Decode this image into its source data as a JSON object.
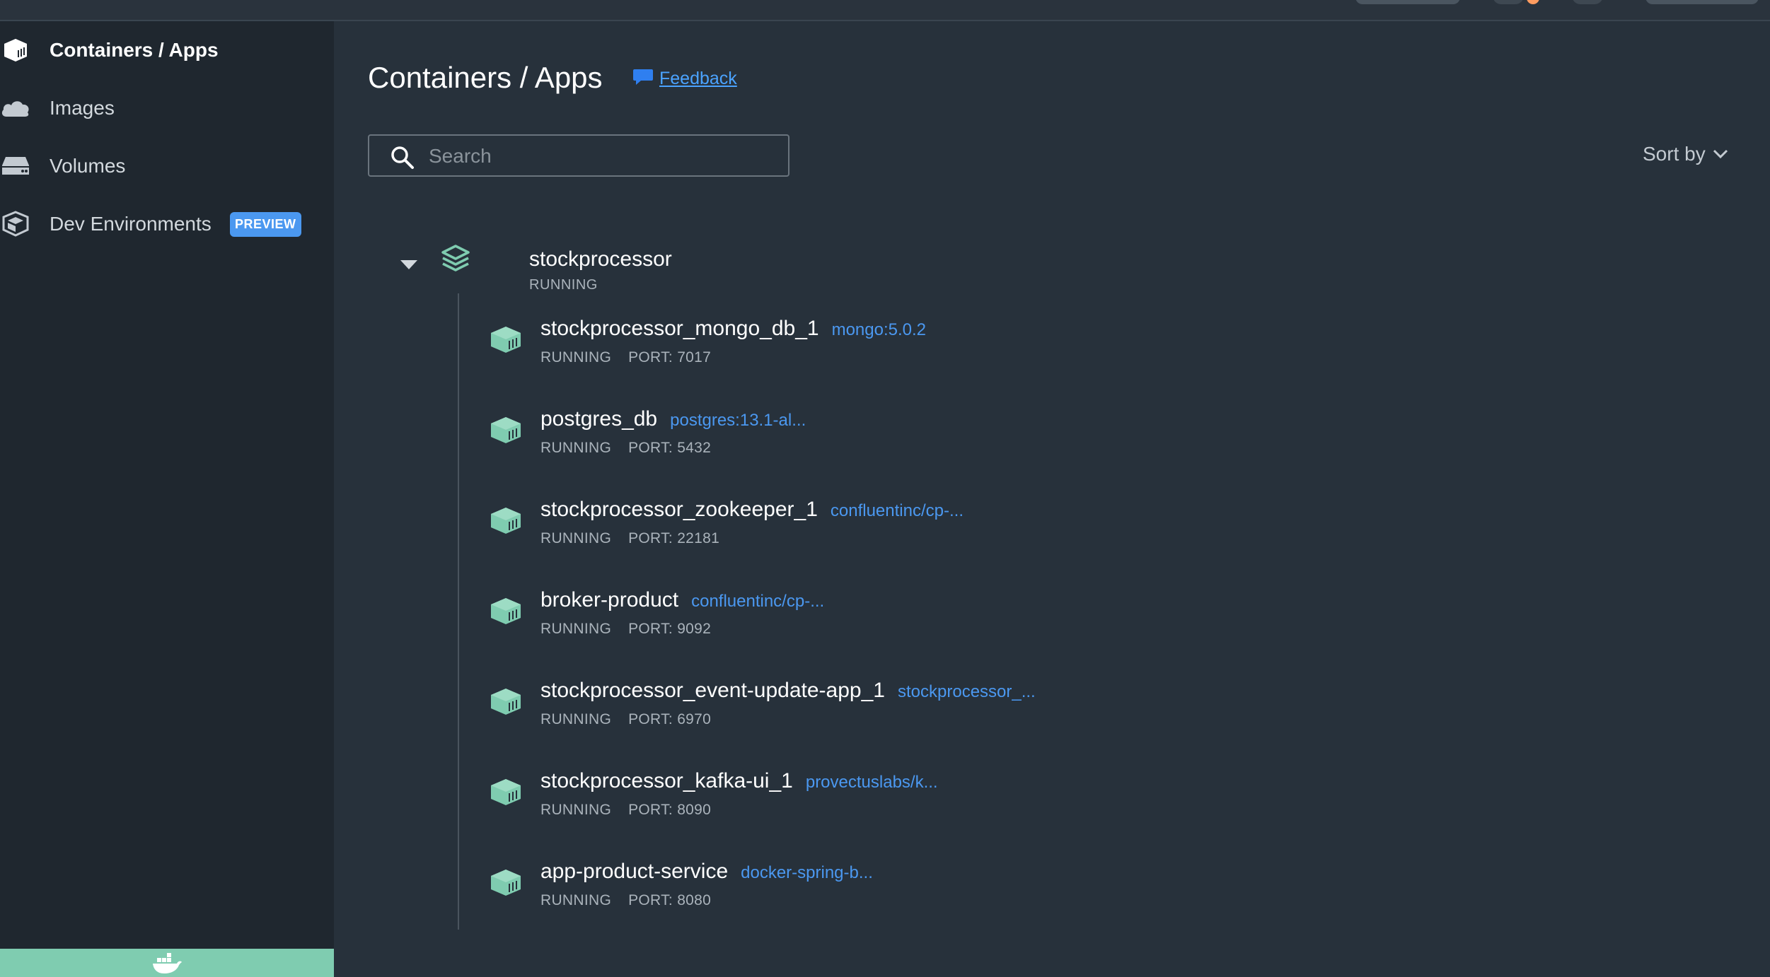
{
  "colors": {
    "background": "#27313b",
    "sidebar": "#1f272f",
    "accent_blue": "#4b98f0",
    "running_green": "#7fccb0",
    "muted_text": "#aab3bb"
  },
  "sidebar": {
    "items": [
      {
        "label": "Containers / Apps",
        "icon": "container-icon",
        "active": true
      },
      {
        "label": "Images",
        "icon": "cloud-icon",
        "active": false
      },
      {
        "label": "Volumes",
        "icon": "volume-icon",
        "active": false
      },
      {
        "label": "Dev Environments",
        "icon": "dev-environments-icon",
        "active": false,
        "badge": "PREVIEW"
      }
    ],
    "footer_icon": "docker-whale-icon"
  },
  "main": {
    "title": "Containers / Apps",
    "feedback_label": "Feedback",
    "search": {
      "placeholder": "Search",
      "value": ""
    },
    "sort_label": "Sort by",
    "group": {
      "name": "stockprocessor",
      "status": "RUNNING",
      "expanded": true,
      "containers": [
        {
          "name": "stockprocessor_mongo_db_1",
          "image": "mongo:5.0.2",
          "status": "RUNNING",
          "port": "PORT: 7017"
        },
        {
          "name": "postgres_db",
          "image": "postgres:13.1-al...",
          "status": "RUNNING",
          "port": "PORT: 5432"
        },
        {
          "name": "stockprocessor_zookeeper_1",
          "image": "confluentinc/cp-...",
          "status": "RUNNING",
          "port": "PORT: 22181"
        },
        {
          "name": "broker-product",
          "image": "confluentinc/cp-...",
          "status": "RUNNING",
          "port": "PORT: 9092"
        },
        {
          "name": "stockprocessor_event-update-app_1",
          "image": "stockprocessor_...",
          "status": "RUNNING",
          "port": "PORT: 6970"
        },
        {
          "name": "stockprocessor_kafka-ui_1",
          "image": "provectuslabs/k...",
          "status": "RUNNING",
          "port": "PORT: 8090"
        },
        {
          "name": "app-product-service",
          "image": "docker-spring-b...",
          "status": "RUNNING",
          "port": "PORT: 8080"
        }
      ]
    }
  }
}
